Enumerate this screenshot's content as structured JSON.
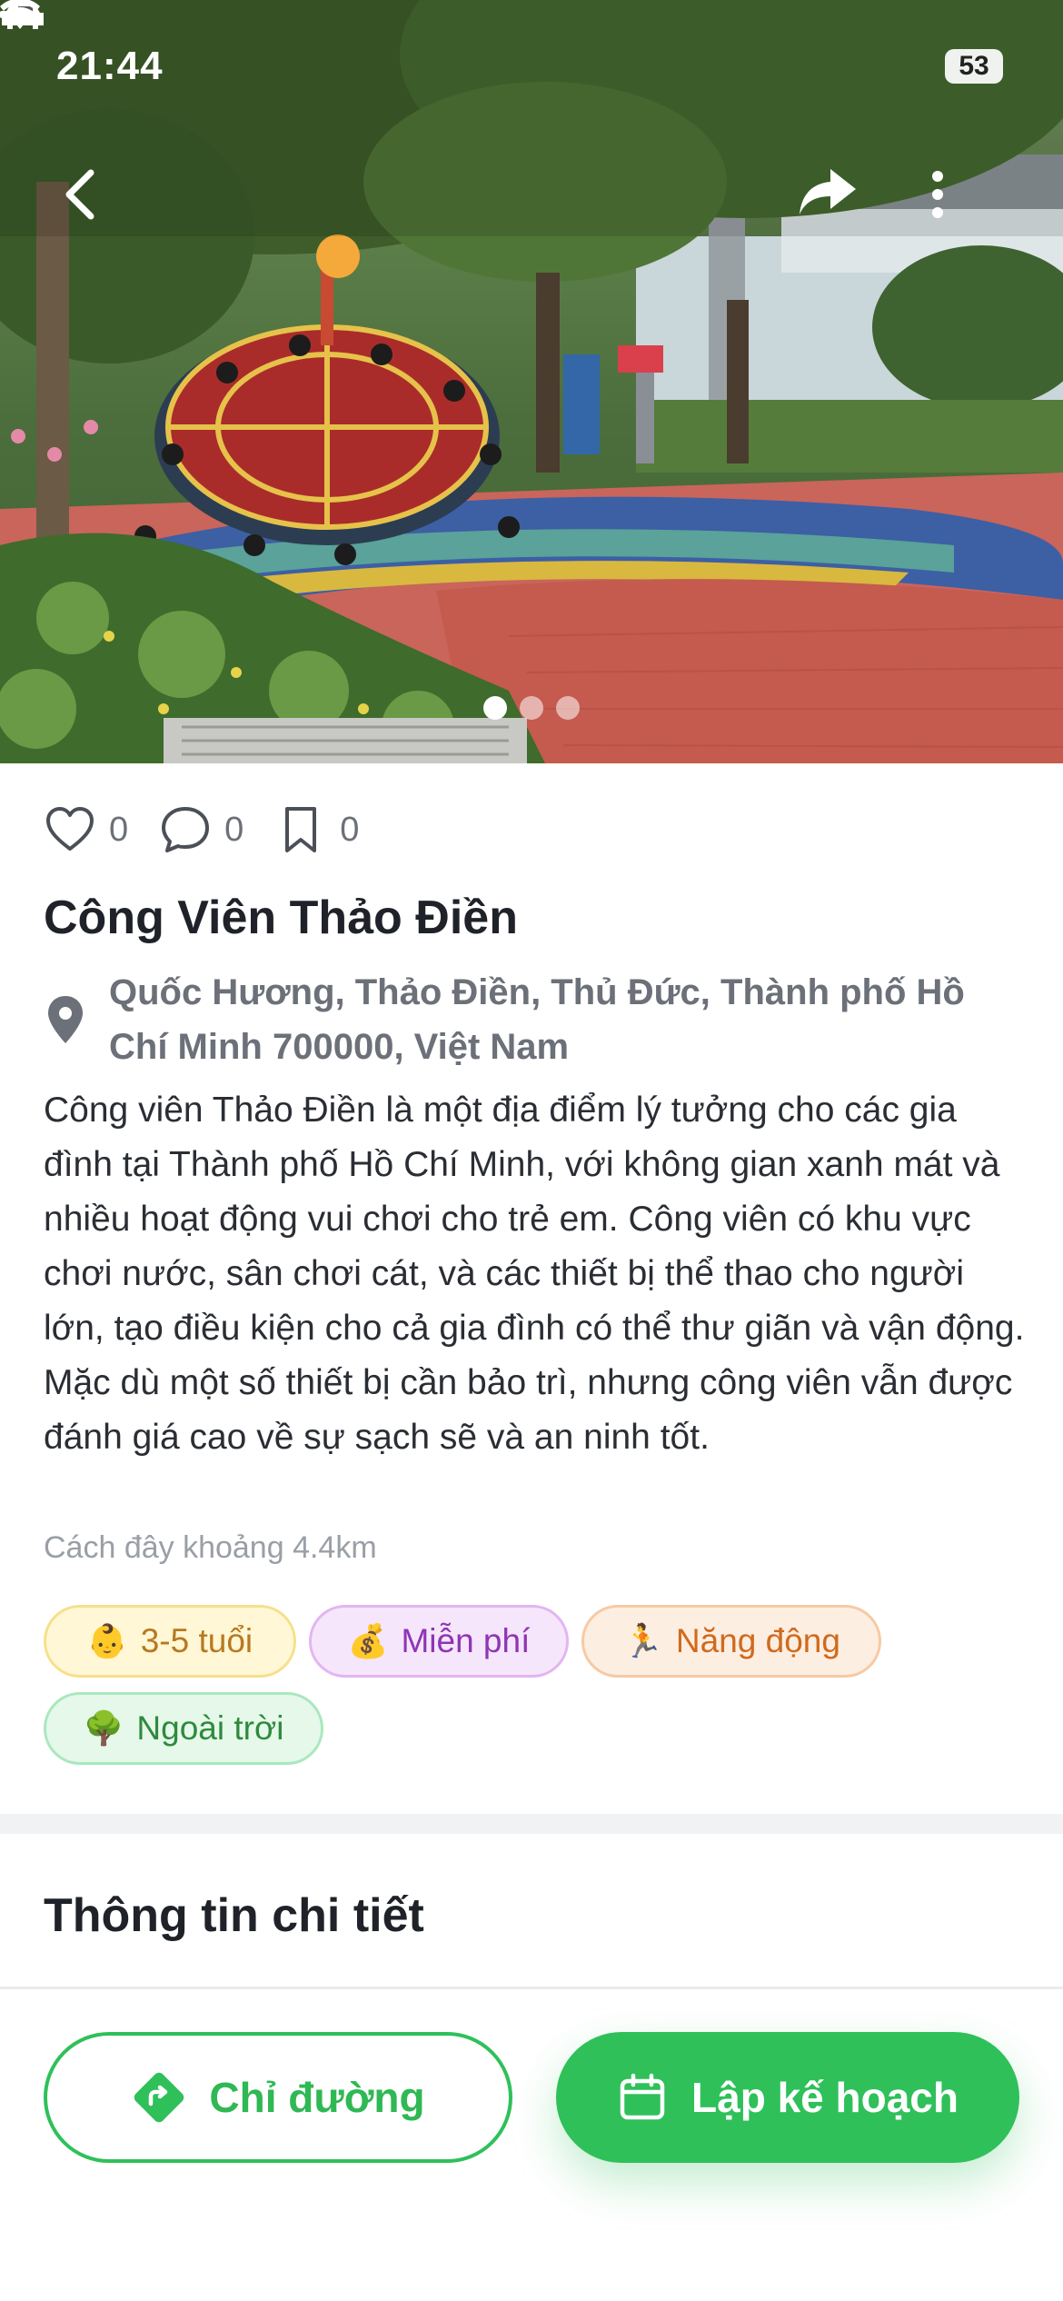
{
  "status_bar": {
    "time": "21:44",
    "battery": "53"
  },
  "gallery": {
    "slide_count": 3,
    "active_slide": 1
  },
  "stats": {
    "likes": "0",
    "comments": "0",
    "saves": "0"
  },
  "place": {
    "name": "Công Viên Thảo Điền",
    "address": "Quốc Hương, Thảo Điền, Thủ Đức, Thành phố Hồ Chí Minh 700000, Việt Nam",
    "description": "Công viên Thảo Điền là một địa điểm lý tưởng cho các gia đình tại Thành phố Hồ Chí Minh, với không gian xanh mát và nhiều hoạt động vui chơi cho trẻ em. Công viên có khu vực chơi nước, sân chơi cát, và các thiết bị thể thao cho người lớn, tạo điều kiện cho cả gia đình có thể thư giãn và vận động. Mặc dù một số thiết bị cần bảo trì, nhưng công viên vẫn được đánh giá cao về sự sạch sẽ và an ninh tốt.",
    "distance": "Cách đây khoảng 4.4km"
  },
  "tags": {
    "age": {
      "emoji": "👶",
      "label": "3-5 tuổi"
    },
    "price": {
      "emoji": "💰",
      "label": "Miễn phí"
    },
    "activity": {
      "emoji": "🏃",
      "label": "Năng động"
    },
    "setting": {
      "emoji": "🌳",
      "label": "Ngoài trời"
    }
  },
  "section": {
    "title": "Thông tin chi tiết"
  },
  "actions": {
    "directions_label": "Chỉ đường",
    "plan_label": "Lập kế hoạch"
  },
  "colors": {
    "accent_green": "#2fc05a",
    "text_primary": "#1f2329",
    "text_muted": "#6c7079"
  }
}
